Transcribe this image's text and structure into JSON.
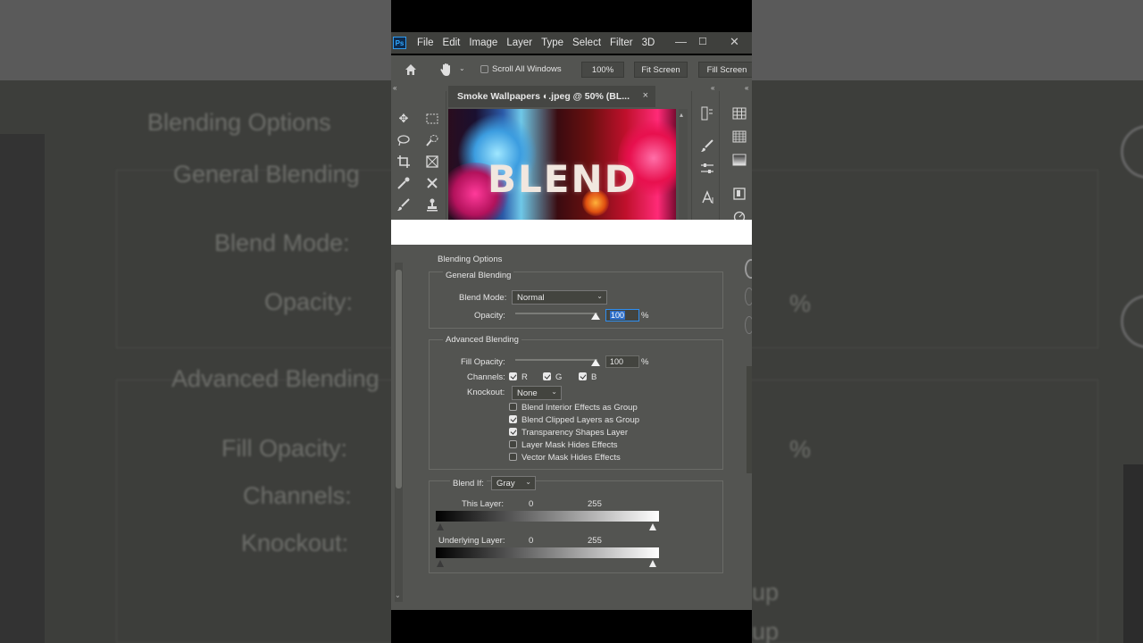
{
  "background": {
    "blending_options": "Blending Options",
    "general_blending": "General Blending",
    "blend_mode": "Blend Mode:",
    "opacity": "Opacity:",
    "advanced_blending": "Advanced Blending",
    "fill_opacity": "Fill Opacity:",
    "channels": "Channels:",
    "knockout": "Knockout:",
    "percent": "%",
    "up1": "up",
    "up2": "up"
  },
  "menubar": {
    "logo": "Ps",
    "items": [
      "File",
      "Edit",
      "Image",
      "Layer",
      "Type",
      "Select",
      "Filter",
      "3D"
    ],
    "minimize": "—",
    "maximize": "☐",
    "close": "✕"
  },
  "optionsbar": {
    "scroll_all_windows": "Scroll All Windows",
    "zoom": "100%",
    "fit_screen": "Fit Screen",
    "fill_screen": "Fill Screen"
  },
  "document": {
    "tab_title": "Smoke Wallpapers ◐.jpeg @ 50% (BL...",
    "tab_close": "×",
    "canvas_text": "BLEND"
  },
  "dialog": {
    "title": "Blending Options",
    "general_blending": "General Blending",
    "blend_mode_label": "Blend Mode:",
    "blend_mode_value": "Normal",
    "opacity_label": "Opacity:",
    "opacity_value": "100",
    "opacity_fraction": 1.0,
    "percent": "%",
    "advanced_blending": "Advanced Blending",
    "fill_opacity_label": "Fill Opacity:",
    "fill_opacity_value": "100",
    "fill_opacity_fraction": 1.0,
    "channels_label": "Channels:",
    "channels": [
      {
        "label": "R",
        "checked": true
      },
      {
        "label": "G",
        "checked": true
      },
      {
        "label": "B",
        "checked": true
      }
    ],
    "knockout_label": "Knockout:",
    "knockout_value": "None",
    "options": [
      {
        "label": "Blend Interior Effects as Group",
        "checked": false
      },
      {
        "label": "Blend Clipped Layers as Group",
        "checked": true
      },
      {
        "label": "Transparency Shapes Layer",
        "checked": true
      },
      {
        "label": "Layer Mask Hides Effects",
        "checked": false
      },
      {
        "label": "Vector Mask Hides Effects",
        "checked": false
      }
    ],
    "blend_if_label": "Blend If:",
    "blend_if_value": "Gray",
    "this_layer_label": "This Layer:",
    "this_layer_min": "0",
    "this_layer_max": "255",
    "underlying_layer_label": "Underlying Layer:",
    "underlying_layer_min": "0",
    "underlying_layer_max": "255"
  },
  "colors": {
    "panel": "#535451",
    "menubar": "#3f403d",
    "accent": "#2e8ef0"
  }
}
